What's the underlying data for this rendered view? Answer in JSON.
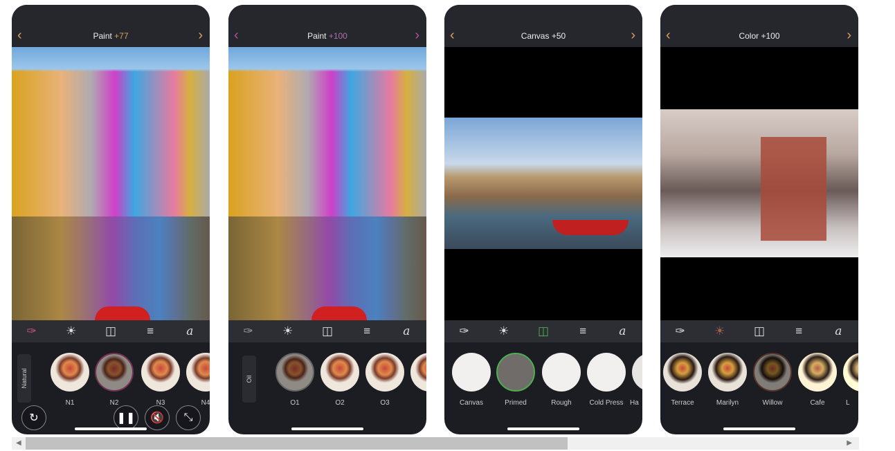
{
  "screens": [
    {
      "title": "Paint",
      "value": "+77",
      "value_color": "#d9a060",
      "arrow_color": "#d9a060",
      "active_tool": "brush",
      "active_color": "#c0508a",
      "category": "Natural",
      "items": [
        "N1",
        "N2",
        "N3",
        "N4"
      ],
      "selected": 1
    },
    {
      "title": "Paint",
      "value": "+100",
      "value_color": "#b070b0",
      "arrow_color": "#b050a0",
      "category": "Oil",
      "items": [
        "O1",
        "O2",
        "O3",
        ""
      ],
      "selected": 0
    },
    {
      "title": "Canvas",
      "value": "+50",
      "value_color": "#eeeeee",
      "arrow_color": "#d9a060",
      "active_tool": "canvas",
      "active_color": "#4caf50",
      "items": [
        "Canvas",
        "Primed",
        "Rough",
        "Cold Press",
        "Ha"
      ],
      "selected": 1
    },
    {
      "title": "Color",
      "value": "+100",
      "value_color": "#eeeeee",
      "arrow_color": "#d9a060",
      "active_tool": "palette",
      "active_color": "#a0604a",
      "items": [
        "Terrace",
        "Marilyn",
        "Willow",
        "Cafe",
        "L"
      ],
      "selected": 2
    }
  ],
  "icons": [
    "brush-icon",
    "palette-icon",
    "easel-icon",
    "sliders-icon",
    "font-icon"
  ],
  "controls": [
    "reset-icon",
    "pause-icon",
    "mute-icon",
    "expand-icon"
  ]
}
